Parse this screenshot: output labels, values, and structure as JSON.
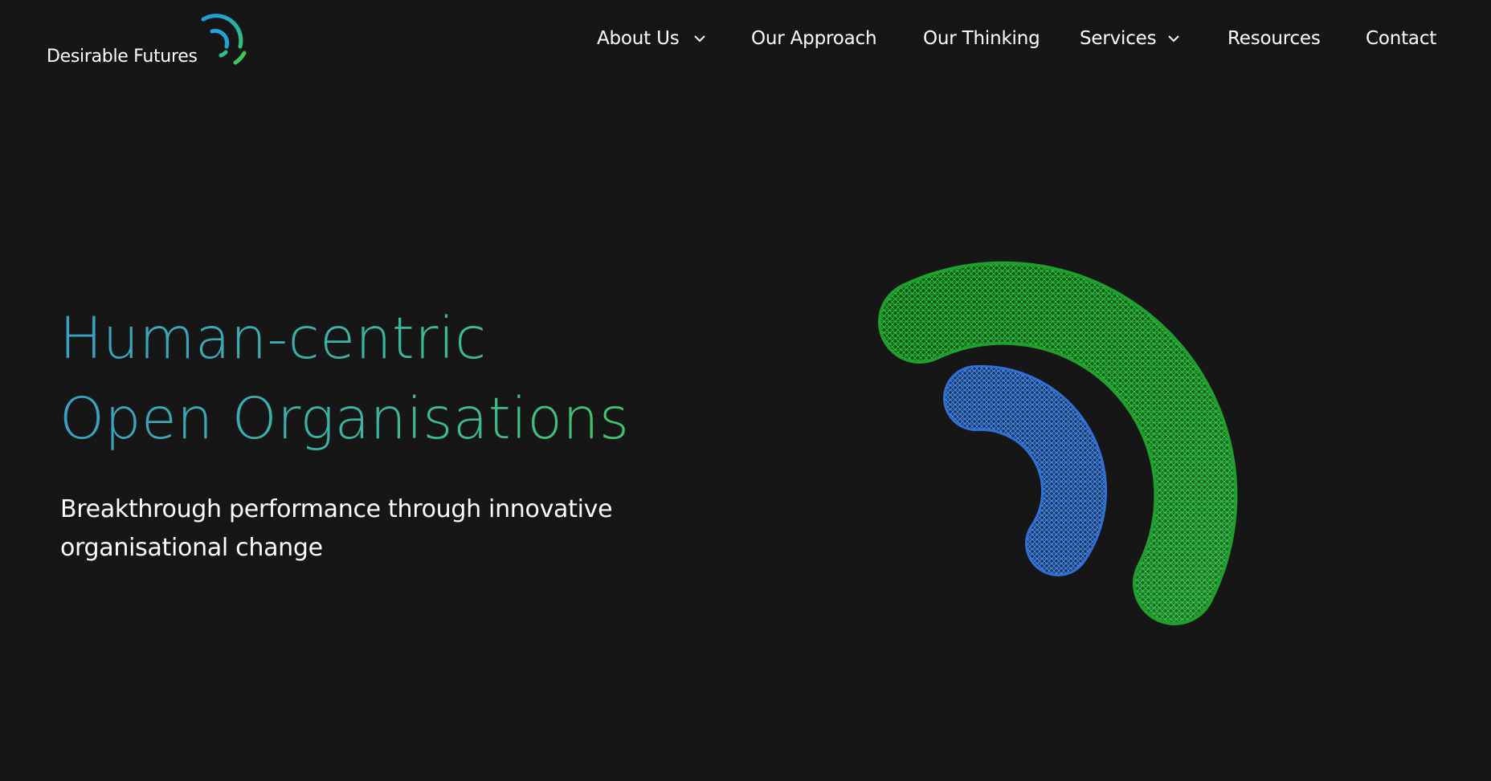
{
  "brand": {
    "name": "Desirable Futures",
    "colors": {
      "blue": "#1e9be3",
      "green": "#2fcf5a",
      "background": "#161616"
    }
  },
  "nav": {
    "items": [
      {
        "label": "About Us",
        "has_dropdown": true
      },
      {
        "label": "Our Approach",
        "has_dropdown": false
      },
      {
        "label": "Our Thinking",
        "has_dropdown": false
      },
      {
        "label": "Services",
        "has_dropdown": true
      },
      {
        "label": "Resources",
        "has_dropdown": false
      },
      {
        "label": "Contact",
        "has_dropdown": false
      }
    ],
    "dropdown_icon": "chevron-down-icon"
  },
  "hero": {
    "title_line1": "Human-centric",
    "title_line2": "Open Organisations",
    "subtitle": "Breakthrough performance through innovative organisational change",
    "artwork": {
      "icon": "wireframe-arcs-graphic",
      "outer_color": "#22c83a",
      "inner_color": "#3a82ee"
    }
  }
}
